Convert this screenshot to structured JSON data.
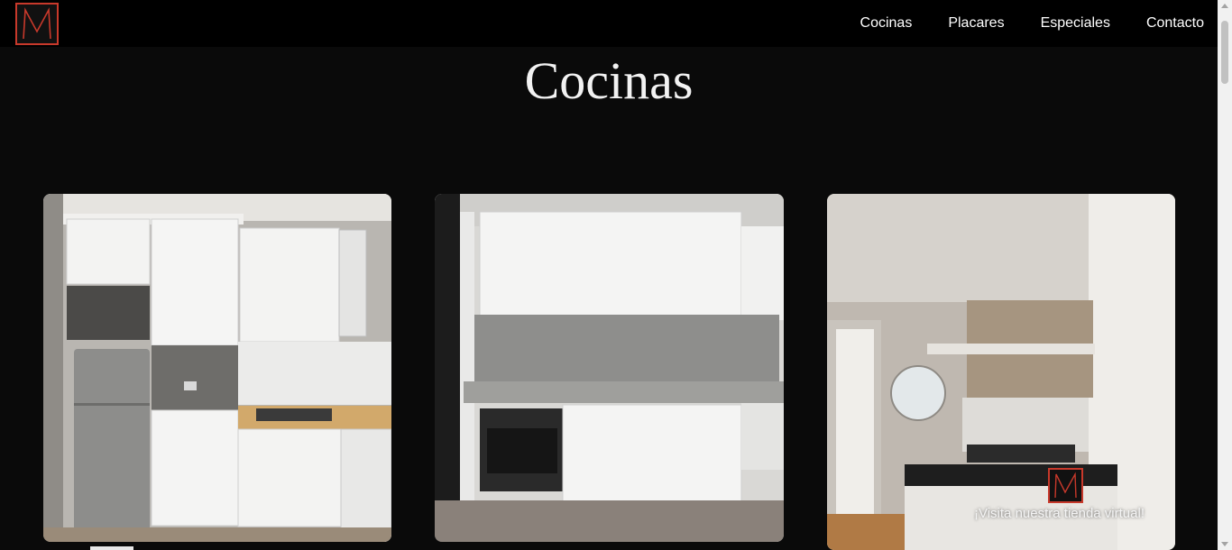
{
  "nav": {
    "items": [
      {
        "label": "Cocinas"
      },
      {
        "label": "Placares"
      },
      {
        "label": "Especiales"
      },
      {
        "label": "Contacto"
      }
    ]
  },
  "page": {
    "title": "Cocinas"
  },
  "gallery": {
    "images": [
      {
        "icon": "kitchen-photo-white-cabinets-wood-counter"
      },
      {
        "icon": "kitchen-photo-granite-backsplash-oven"
      },
      {
        "icon": "kitchen-photo-island-round-mirror"
      }
    ]
  },
  "store_link": {
    "label": "¡Visita nuestra tienda virtual!"
  },
  "colors": {
    "accent": "#c8392b",
    "background": "#0a0a0a",
    "navbar": "#000000"
  }
}
